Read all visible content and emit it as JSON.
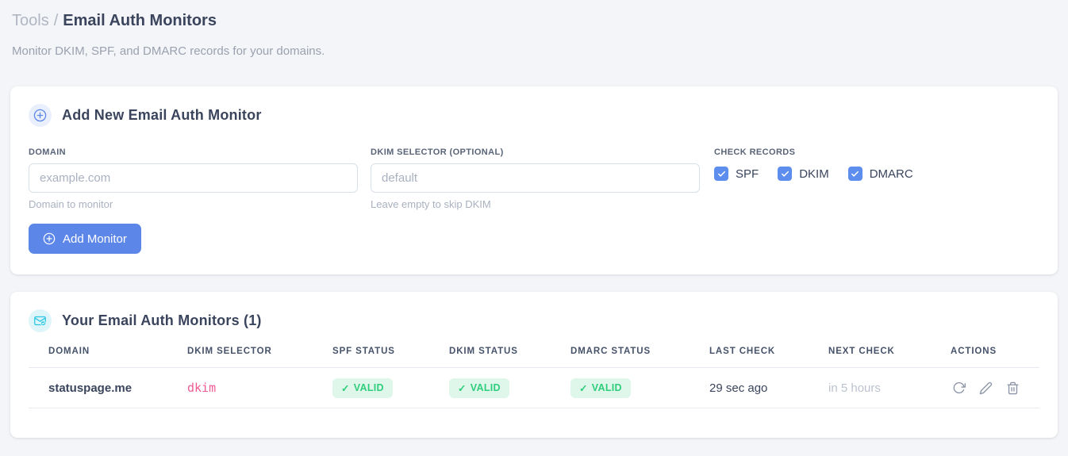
{
  "page": {
    "breadcrumb": {
      "section": "Tools",
      "separator": "/",
      "current": "Email Auth Monitors"
    },
    "subtitle": "Monitor DKIM, SPF, and DMARC records for your domains."
  },
  "add_monitor_card": {
    "icon": "circle-plus-icon",
    "title": "Add New Email Auth Monitor",
    "fields": {
      "domain": {
        "label": "DOMAIN",
        "placeholder": "example.com",
        "value": "",
        "helper": "Domain to monitor"
      },
      "dkim_selector": {
        "label": "DKIM SELECTOR (OPTIONAL)",
        "placeholder": "default",
        "value": "",
        "helper": "Leave empty to skip DKIM"
      }
    },
    "check_records": {
      "label": "CHECK RECORDS",
      "options": [
        {
          "label": "SPF",
          "checked": true
        },
        {
          "label": "DKIM",
          "checked": true
        },
        {
          "label": "DMARC",
          "checked": true
        }
      ]
    },
    "submit_label": "Add Monitor"
  },
  "monitors_card": {
    "icon": "mail-check-icon",
    "title": "Your Email Auth Monitors (1)",
    "badge_check_glyph": "✓",
    "table": {
      "columns": [
        "DOMAIN",
        "DKIM SELECTOR",
        "SPF STATUS",
        "DKIM STATUS",
        "DMARC STATUS",
        "LAST CHECK",
        "NEXT CHECK",
        "ACTIONS"
      ],
      "rows": [
        {
          "domain": "statuspage.me",
          "dkim_selector": "dkim",
          "spf_status": "VALID",
          "dkim_status": "VALID",
          "dmarc_status": "VALID",
          "last_check": "29 sec ago",
          "next_check": "in 5 hours",
          "actions": [
            "refresh-icon",
            "edit-icon",
            "delete-icon"
          ]
        }
      ]
    }
  },
  "colors": {
    "accent_blue": "#5C86E8",
    "checkbox_blue": "#5D8DED",
    "icon_cyan": "#29C5E2",
    "badge_green_bg": "#DFF6EA",
    "badge_green_text": "#2FCE7C",
    "selector_pink": "#EE5A93",
    "page_background": "#F4F5F8"
  }
}
